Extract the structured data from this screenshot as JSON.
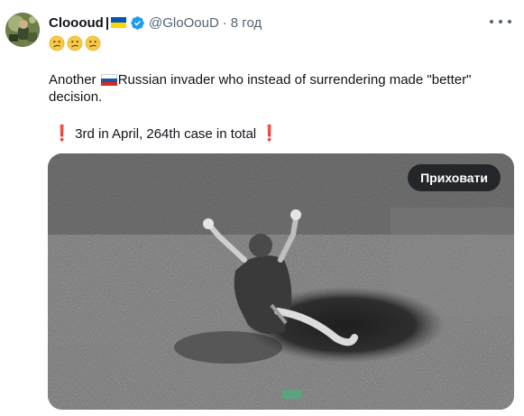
{
  "tweet": {
    "author_name": "Cloooud",
    "name_separator": "|",
    "handle": "@GloOouD",
    "dot": "·",
    "timestamp": "8 год",
    "text_line1_before_flag": "Another ",
    "text_line1_after_flag": "Russian invader who instead of surrendering made \"better\"",
    "text_line2": "decision.",
    "text_line3": "3rd in April, 264th case in total",
    "exclamation": "❗"
  },
  "media": {
    "hide_button_label": "Приховати"
  },
  "icons": {
    "avatar": "profile-avatar",
    "flag_ua": "ukraine-flag-icon",
    "verified": "verified-badge-icon",
    "emoji": "confused-face-emoji",
    "flag_ru": "russia-flag-icon",
    "more": "more-options-icon"
  },
  "colors": {
    "verified_blue": "#1d9bf0",
    "secondary_text": "#536471",
    "exclamation_red": "#e0263a"
  }
}
